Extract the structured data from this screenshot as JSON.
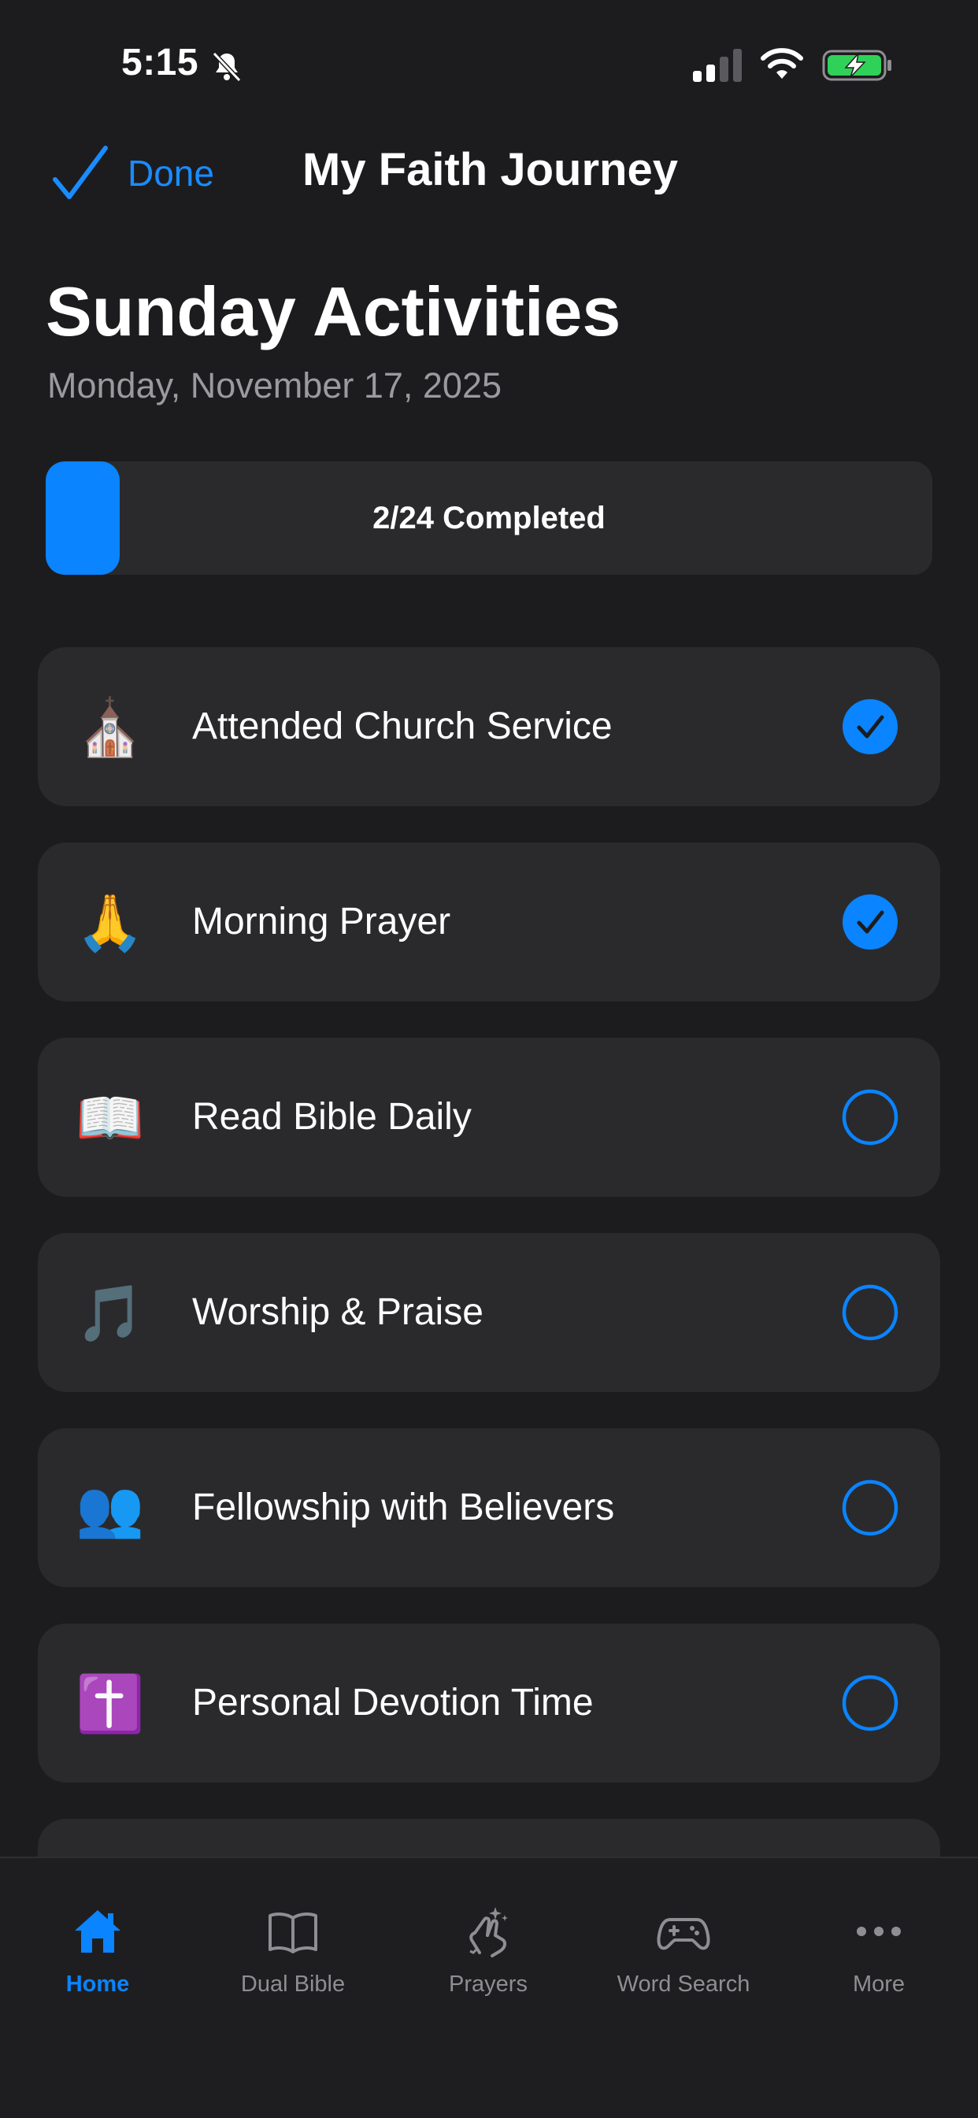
{
  "status_bar": {
    "time": "5:15",
    "silent_mode": true,
    "battery_charging": true
  },
  "nav": {
    "done_label": "Done",
    "title": "My Faith Journey"
  },
  "header": {
    "title": "Sunday Activities",
    "date": "Monday, November 17, 2025"
  },
  "progress": {
    "completed": 2,
    "total": 24,
    "label": "2/24 Completed"
  },
  "activities": [
    {
      "emoji": "⛪",
      "icon": "church-icon",
      "label": "Attended Church Service",
      "checked": true
    },
    {
      "emoji": "🙏",
      "icon": "praying-hands-icon",
      "label": "Morning Prayer",
      "checked": true
    },
    {
      "emoji": "📖",
      "icon": "open-book-icon",
      "label": "Read Bible Daily",
      "checked": false
    },
    {
      "emoji": "🎵",
      "icon": "music-notes-icon",
      "label": "Worship & Praise",
      "checked": false
    },
    {
      "emoji": "👥",
      "icon": "people-icon",
      "label": "Fellowship with Believers",
      "checked": false
    },
    {
      "emoji": "✝️",
      "icon": "cross-icon",
      "label": "Personal Devotion Time",
      "checked": false
    }
  ],
  "tabs": [
    {
      "label": "Home",
      "icon": "house-icon",
      "active": true
    },
    {
      "label": "Dual Bible",
      "icon": "book-icon",
      "active": false
    },
    {
      "label": "Prayers",
      "icon": "praying-hands-icon",
      "active": false
    },
    {
      "label": "Word Search",
      "icon": "gamepad-icon",
      "active": false
    },
    {
      "label": "More",
      "icon": "ellipsis-icon",
      "active": false
    }
  ],
  "colors": {
    "accent": "#0a84ff",
    "background": "#1c1c1e",
    "card": "#2a2a2c",
    "secondary_text": "#9a9a9f"
  }
}
